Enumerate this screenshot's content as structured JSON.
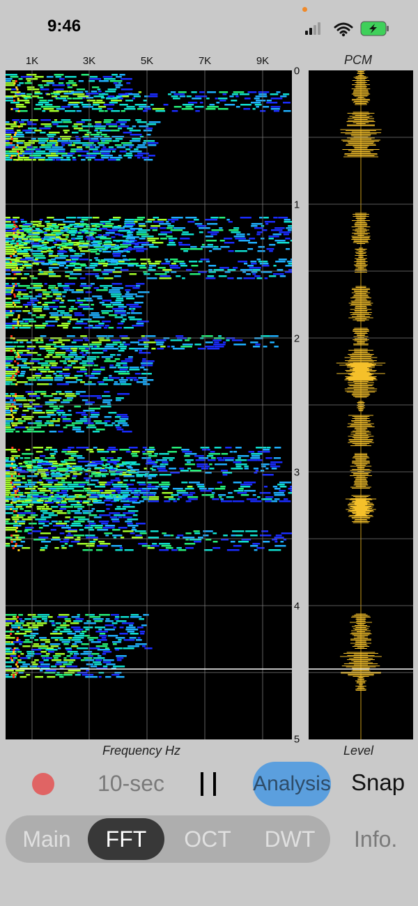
{
  "status": {
    "time": "9:46"
  },
  "spectrogram": {
    "freq_ticks": [
      "1K",
      "3K",
      "5K",
      "7K",
      "9K"
    ],
    "time_ticks": [
      "0",
      "1",
      "2",
      "3",
      "4",
      "5"
    ],
    "xlabel": "Frequency Hz"
  },
  "pcm": {
    "title": "PCM",
    "xlabel": "Level"
  },
  "controls": {
    "duration_label": "10-sec",
    "analysis_label": "Analysis",
    "snap_label": "Snap"
  },
  "tabs": [
    {
      "label": "Main"
    },
    {
      "label": "FFT"
    },
    {
      "label": "OCT"
    },
    {
      "label": "DWT"
    }
  ],
  "info_label": "Info.",
  "colors": {
    "record": "#e06464",
    "analysis_active": "#5b9fde",
    "pcm_waveform": "#f5c02a",
    "tab_selected": "#383838"
  }
}
